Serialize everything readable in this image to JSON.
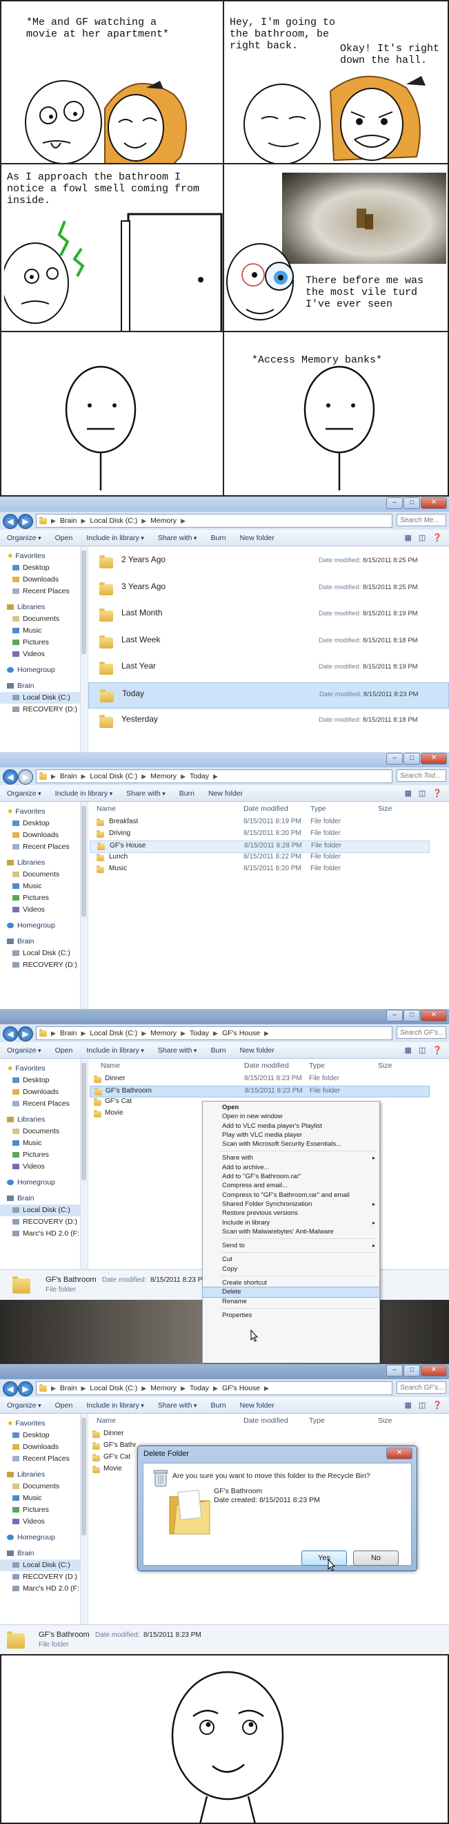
{
  "comic": {
    "panel1_caption": "*Me and GF watching a\nmovie at her apartment*",
    "panel2_caption": "Hey, I'm going to\nthe bathroom, be\nright back.",
    "panel2_reply": "Okay! It's right\ndown the hall.",
    "panel3_caption": "As I approach the bathroom I\nnotice a fowl smell coming from\ninside.",
    "panel4_caption": "There before me was\nthe most vile turd\nI've ever seen",
    "panel6_caption": "*Access Memory banks*"
  },
  "colors": {
    "selection": "#cde3f9",
    "window_frame": "#c3d6ee",
    "hair": "#e8a23c"
  },
  "win1": {
    "path": [
      "Brain",
      "Local Disk (C:)",
      "Memory"
    ],
    "search_placeholder": "Search Me...",
    "toolbar": [
      "Organize",
      "Open",
      "Include in library",
      "Share with",
      "Burn",
      "New folder"
    ],
    "nav": {
      "favorites_header": "Favorites",
      "favorites": [
        "Desktop",
        "Downloads",
        "Recent Places"
      ],
      "libraries_header": "Libraries",
      "libraries": [
        "Documents",
        "Music",
        "Pictures",
        "Videos"
      ],
      "homegroup": "Homegroup",
      "computer_header": "Brain",
      "drives": [
        "Local Disk (C:)",
        "RECOVERY (D:)"
      ]
    },
    "date_label": "Date modified:",
    "folders": [
      {
        "name": "2 Years Ago",
        "date": "8/15/2011 8:25 PM"
      },
      {
        "name": "3 Years Ago",
        "date": "8/15/2011 8:25 PM"
      },
      {
        "name": "Last Month",
        "date": "8/15/2011 8:19 PM"
      },
      {
        "name": "Last Week",
        "date": "8/15/2011 8:18 PM"
      },
      {
        "name": "Last Year",
        "date": "8/15/2011 8:19 PM"
      },
      {
        "name": "Today",
        "date": "8/15/2011 8:23 PM"
      },
      {
        "name": "Yesterday",
        "date": "8/15/2011 8:18 PM"
      }
    ]
  },
  "win2": {
    "path": [
      "Brain",
      "Local Disk (C:)",
      "Memory",
      "Today"
    ],
    "search_placeholder": "Search Tod...",
    "toolbar": [
      "Organize",
      "Include in library",
      "Share with",
      "Burn",
      "New folder"
    ],
    "columns": [
      "Name",
      "Date modified",
      "Type",
      "Size"
    ],
    "rows": [
      {
        "name": "Breakfast",
        "date": "8/15/2011 8:19 PM",
        "type": "File folder"
      },
      {
        "name": "Driving",
        "date": "8/15/2011 8:20 PM",
        "type": "File folder"
      },
      {
        "name": "GF's House",
        "date": "8/15/2011 8:28 PM",
        "type": "File folder"
      },
      {
        "name": "Lunch",
        "date": "8/15/2011 8:22 PM",
        "type": "File folder"
      },
      {
        "name": "Music",
        "date": "8/15/2011 8:20 PM",
        "type": "File folder"
      }
    ]
  },
  "win3": {
    "path": [
      "Brain",
      "Local Disk (C:)",
      "Memory",
      "Today",
      "GF's House"
    ],
    "search_placeholder": "Search GF's...",
    "toolbar": [
      "Organize",
      "Open",
      "Include in library",
      "Share with",
      "Burn",
      "New folder"
    ],
    "columns": [
      "Name",
      "Date modified",
      "Type",
      "Size"
    ],
    "rows": [
      {
        "name": "Dinner",
        "date": "8/15/2011 8:23 PM",
        "type": "File folder"
      },
      {
        "name": "GF's Bathroom",
        "date": "8/15/2011 8:23 PM",
        "type": "File folder"
      },
      {
        "name": "GF's Cat",
        "date": "",
        "type": ""
      },
      {
        "name": "Movie",
        "date": "",
        "type": ""
      }
    ],
    "extra_drive": "Marc's HD 2.0 (F:",
    "status": {
      "name": "GF's Bathroom",
      "date_label": "Date modified:",
      "date": "8/15/2011 8:23 PM",
      "kind": "File folder"
    },
    "context_menu": [
      {
        "label": "Open",
        "bold": true
      },
      {
        "label": "Open in new window"
      },
      {
        "label": "Add to VLC media player's Playlist"
      },
      {
        "label": "Play with VLC media player"
      },
      {
        "label": "Scan with Microsoft Security Essentials..."
      },
      {
        "sep": true
      },
      {
        "label": "Share with",
        "arrow": true
      },
      {
        "label": "Add to archive..."
      },
      {
        "label": "Add to \"GF's Bathroom.rar\""
      },
      {
        "label": "Compress and email..."
      },
      {
        "label": "Compress to \"GF's Bathroom.rar\" and email"
      },
      {
        "label": "Shared Folder Synchronization",
        "arrow": true
      },
      {
        "label": "Restore previous versions"
      },
      {
        "label": "Include in library",
        "arrow": true
      },
      {
        "label": "Scan with Malwarebytes' Anti-Malware"
      },
      {
        "sep": true
      },
      {
        "label": "Send to",
        "arrow": true
      },
      {
        "sep": true
      },
      {
        "label": "Cut"
      },
      {
        "label": "Copy"
      },
      {
        "sep": true
      },
      {
        "label": "Create shortcut"
      },
      {
        "label": "Delete",
        "highlight": true
      },
      {
        "label": "Rename"
      },
      {
        "sep": true
      },
      {
        "label": "Properties"
      }
    ]
  },
  "win4": {
    "path": [
      "Brain",
      "Local Disk (C:)",
      "Memory",
      "Today",
      "GF's House"
    ],
    "search_placeholder": "Search GF's...",
    "toolbar": [
      "Organize",
      "Open",
      "Include in library",
      "Share with",
      "Burn",
      "New folder"
    ],
    "columns": [
      "Name",
      "Date modified",
      "Type",
      "Size"
    ],
    "rows": [
      "Dinner",
      "GF's Bathr",
      "GF's Cat",
      "Movie"
    ],
    "extra_drive": "Marc's HD 2.0 (F:",
    "status": {
      "name": "GF's Bathroom",
      "date_label": "Date modified:",
      "date": "8/15/2011 8:23 PM",
      "kind": "File folder"
    },
    "dialog": {
      "title": "Delete Folder",
      "question": "Are you sure you want to move this folder to the Recycle Bin?",
      "item_name": "GF's Bathroom",
      "item_date": "Date created: 8/15/2011 8:23 PM",
      "yes": "Yes",
      "no": "No"
    }
  }
}
